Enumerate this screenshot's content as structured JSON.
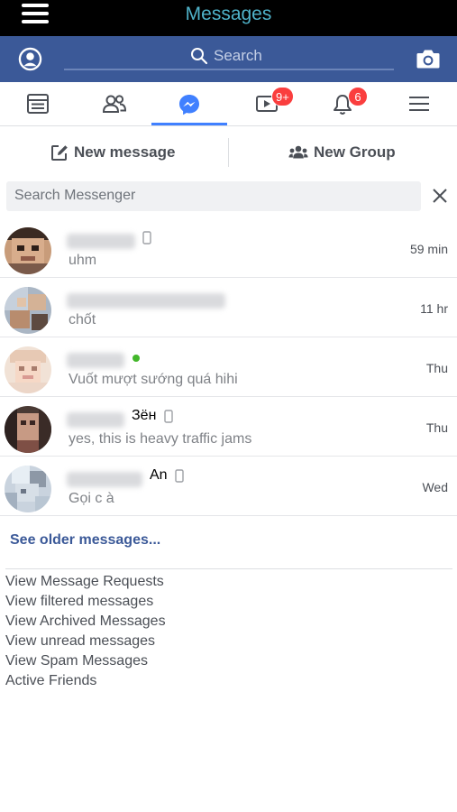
{
  "header": {
    "title": "Messages",
    "menu_icon": "hamburger-icon"
  },
  "searchbar": {
    "placeholder": "Search",
    "profile_icon": "profile-icon",
    "camera_icon": "camera-icon"
  },
  "nav": {
    "tabs": [
      {
        "name": "news-feed",
        "icon": "news-feed-icon",
        "badge": ""
      },
      {
        "name": "friends",
        "icon": "friends-icon",
        "badge": ""
      },
      {
        "name": "messenger",
        "icon": "messenger-icon",
        "badge": "",
        "active": true
      },
      {
        "name": "watch",
        "icon": "video-icon",
        "badge": "9+"
      },
      {
        "name": "notifications",
        "icon": "bell-icon",
        "badge": "6"
      },
      {
        "name": "menu",
        "icon": "menu-icon",
        "badge": ""
      }
    ]
  },
  "actions": {
    "new_message": "New message",
    "new_group": "New Group"
  },
  "messenger_search": {
    "placeholder": "Search Messenger"
  },
  "threads": [
    {
      "name_extra": "",
      "snippet": "uhm",
      "time": "59 min",
      "phone": true,
      "online": false
    },
    {
      "name_extra": "",
      "snippet": "chốt",
      "time": "11 hr",
      "phone": false,
      "online": false
    },
    {
      "name_extra": "",
      "snippet": "Vuốt mượt sướng quá hihi",
      "time": "Thu",
      "phone": false,
      "online": true
    },
    {
      "name_extra": "Зён",
      "snippet": "yes, this is heavy traffic jams",
      "time": "Thu",
      "phone": true,
      "online": false
    },
    {
      "name_extra": "An",
      "snippet": "Gọi c à",
      "time": "Wed",
      "phone": true,
      "online": false
    }
  ],
  "see_older": "See older messages...",
  "links": [
    "View Message Requests",
    "View filtered messages",
    "View Archived Messages",
    "View unread messages",
    "View Spam Messages",
    "Active Friends"
  ],
  "colors": {
    "brand_blue": "#3b5998",
    "active_blue": "#4080ff",
    "badge_red": "#fa3e3e",
    "online_green": "#42b72a"
  }
}
